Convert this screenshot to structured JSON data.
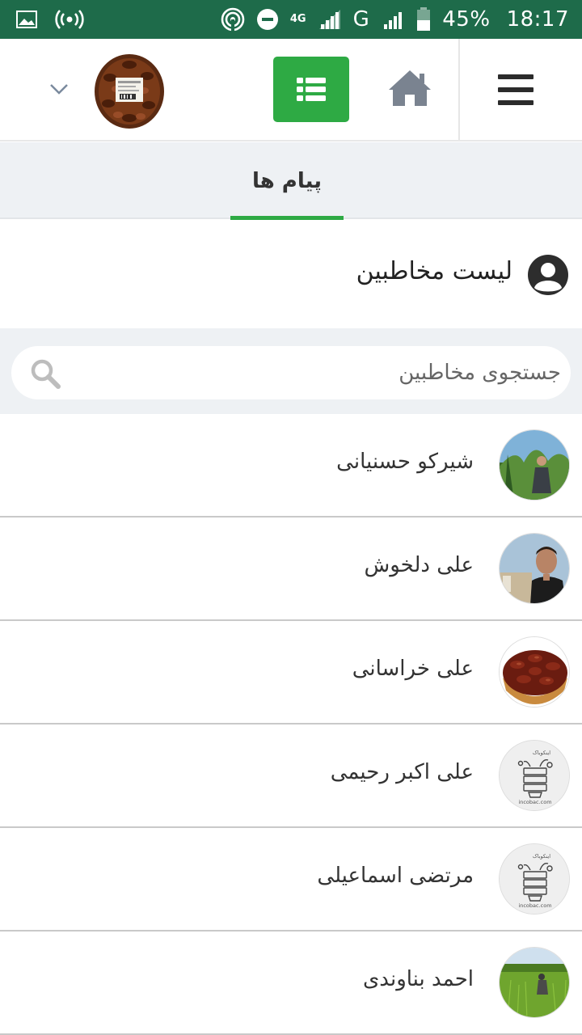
{
  "status_bar": {
    "time": "18:17",
    "battery": "45%",
    "network_type": "G",
    "network_small": "4G",
    "icons": [
      "image-icon",
      "hotspot-icon",
      "wifi-signal-icon",
      "do-not-disturb-icon",
      "signal-icon",
      "battery-icon"
    ]
  },
  "header": {
    "icons": [
      "chevron-down-icon",
      "list-icon",
      "home-icon",
      "hamburger-menu-icon"
    ],
    "accent_color": "#2eaa44"
  },
  "tabs": {
    "messages_label": "پیام ها"
  },
  "section": {
    "title": "لیست مخاطبین"
  },
  "search": {
    "placeholder": "جستجوی مخاطبین"
  },
  "contacts": [
    {
      "name": "شیرکو حسنیانی",
      "avatar": "photo-man-garden"
    },
    {
      "name": "علی دلخوش",
      "avatar": "photo-man-portrait"
    },
    {
      "name": "علی خراسانی",
      "avatar": "photo-dates-bowl"
    },
    {
      "name": "علی اکبر رحیمی",
      "avatar": "incobac-logo",
      "avatar_text_top": "اینکوباک",
      "avatar_text_bottom": "incobac.com"
    },
    {
      "name": "مرتضی اسماعیلی",
      "avatar": "incobac-logo",
      "avatar_text_top": "اینکوباک",
      "avatar_text_bottom": "incobac.com"
    },
    {
      "name": "احمد بناوندی",
      "avatar": "photo-green-field"
    }
  ]
}
